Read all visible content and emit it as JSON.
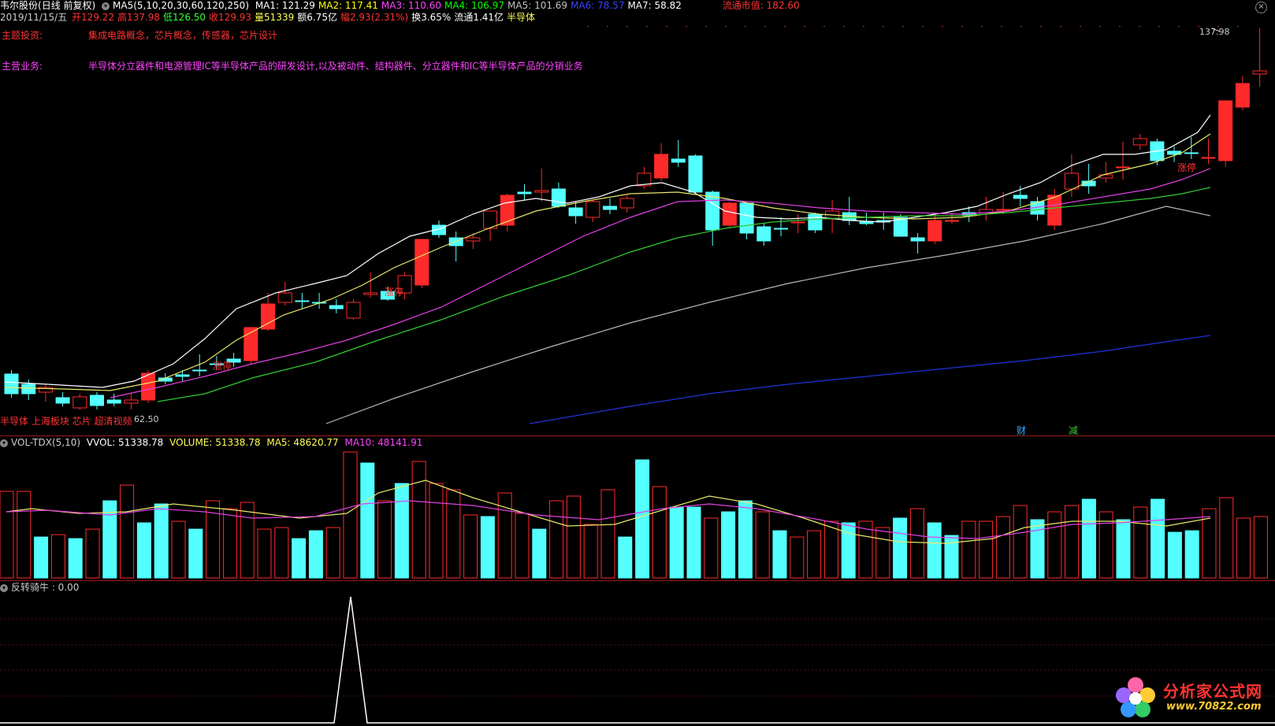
{
  "header": {
    "stock_name": "韦尔股份",
    "period": "(日线 前复权)",
    "ma_params": "MA5(5,10,20,30,60,120,250)",
    "ma": [
      {
        "label": "MA1: 121.29",
        "color": "#ffffff"
      },
      {
        "label": "MA2: 117.41",
        "color": "#ffff00"
      },
      {
        "label": "MA3: 110.60",
        "color": "#ff44ff"
      },
      {
        "label": "MA4: 106.97",
        "color": "#00ff00"
      },
      {
        "label": "MA5: 101.69",
        "color": "#c0c0c0"
      },
      {
        "label": "MA6: 78.57",
        "color": "#3344ff"
      },
      {
        "label": "MA7: 58.82",
        "color": "#ffffff"
      }
    ],
    "float_mv": "流通市值: 182.60",
    "date": "2019/11/15/五",
    "quote": [
      {
        "label": "开129.22",
        "color": "#ff3333"
      },
      {
        "label": "高137.98",
        "color": "#ff3333"
      },
      {
        "label": "低126.50",
        "color": "#33ff33"
      },
      {
        "label": "收129.93",
        "color": "#ff3333"
      },
      {
        "label": "量51339",
        "color": "#ffff55"
      },
      {
        "label": "额6.75亿",
        "color": "#ffffff"
      },
      {
        "label": "幅2.93(2.31%)",
        "color": "#ff3333"
      },
      {
        "label": "换3.65%",
        "color": "#ffffff"
      },
      {
        "label": "流通1.41亿",
        "color": "#ffffff"
      },
      {
        "label": "半导体",
        "color": "#ffff55"
      }
    ]
  },
  "info": {
    "theme_label": "主题投资:",
    "theme_value": "集成电路概念，芯片概念，传感器，芯片设计",
    "business_label": "主营业务:",
    "business_value": "半导体分立器件和电源管理IC等半导体产品的研发设计,以及被动件、结构器件、分立器件和IC等半导体产品的分销业务"
  },
  "annotations": {
    "limit_up": "涨停",
    "high_price": "137.98",
    "low_price": "62.50",
    "sector_tags": "半导体 上海板块 芯片 超清视频",
    "badge_cai": "财",
    "badge_jian": "减"
  },
  "volume_panel": {
    "title": "VOL-TDX(5,10)",
    "vvol": "VVOL: 51338.78",
    "volume": "VOLUME: 51338.78",
    "ma5": "MA5: 48620.77",
    "ma10": "MA10: 48141.91"
  },
  "indicator_panel": {
    "title": "反转骑牛 : 0.00"
  },
  "logo": {
    "name": "分析家公式网",
    "url": "www.70822.com"
  },
  "colors": {
    "up": "#ff2a2a",
    "down": "#54ffff",
    "ma1": "#ffffff",
    "ma2": "#e8e86a",
    "ma3": "#e040e0",
    "ma4": "#33cc33",
    "ma5": "#b8b8b8",
    "ma6": "#2233dd"
  }
}
